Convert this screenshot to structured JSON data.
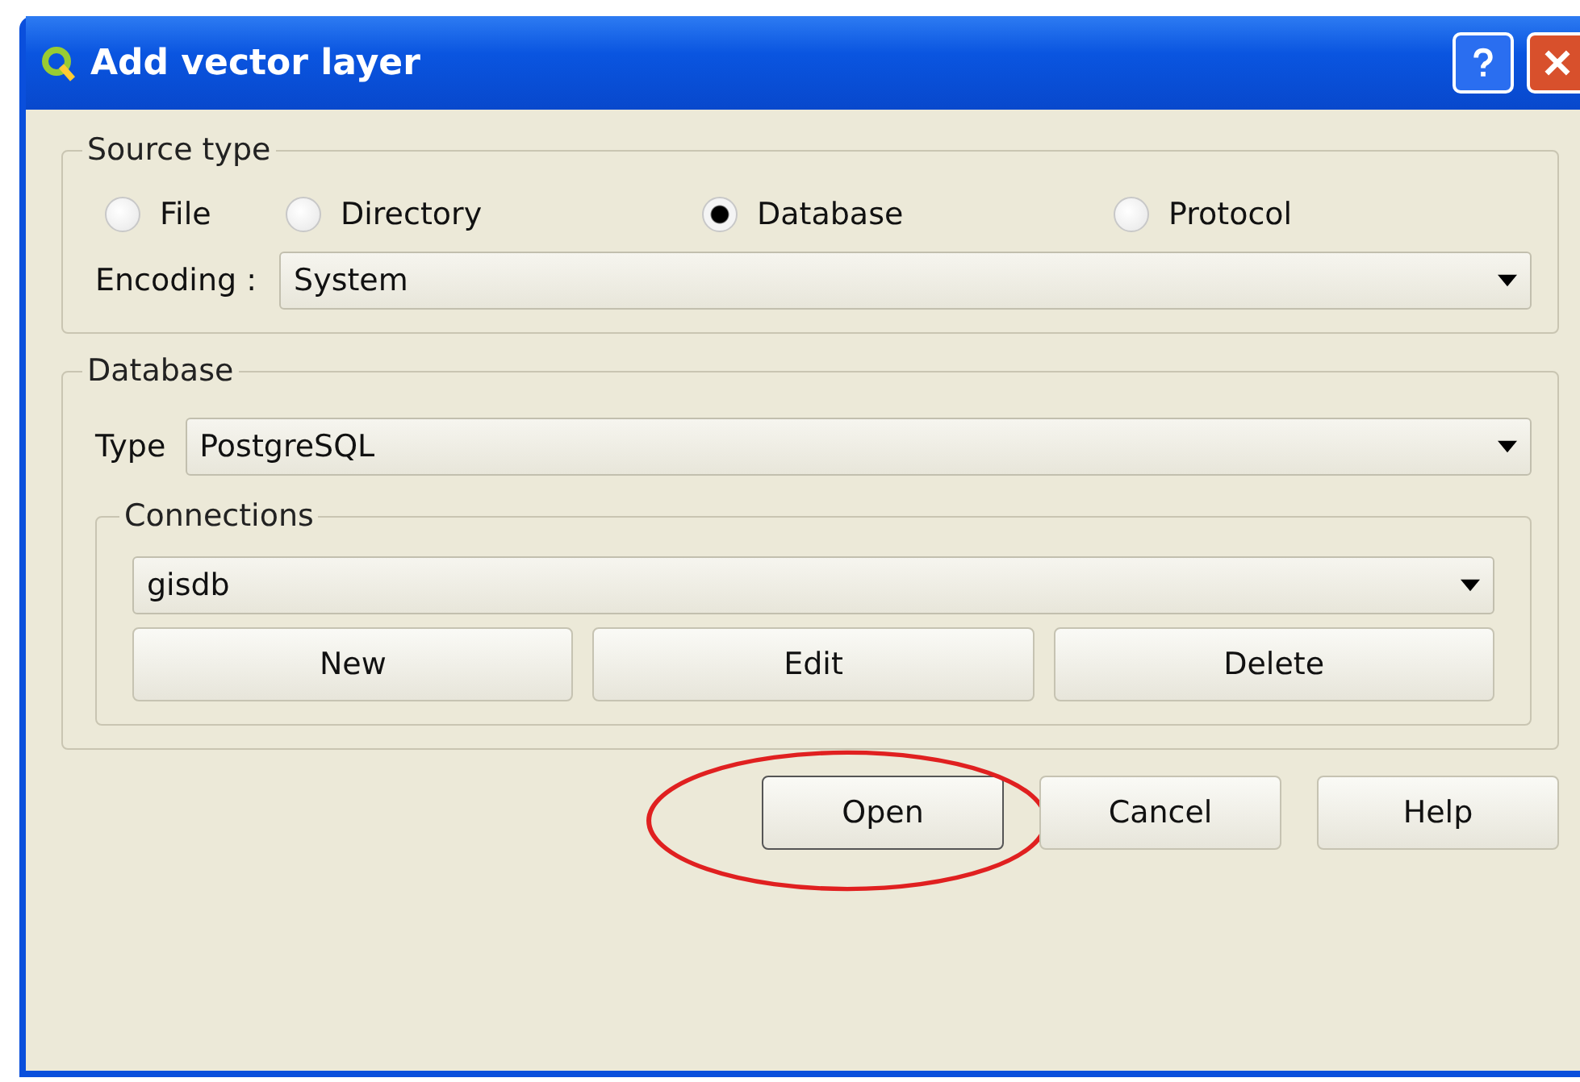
{
  "window": {
    "title": "Add vector layer"
  },
  "source_type": {
    "legend": "Source type",
    "options": [
      {
        "label": "File",
        "selected": false
      },
      {
        "label": "Directory",
        "selected": false
      },
      {
        "label": "Database",
        "selected": true
      },
      {
        "label": "Protocol",
        "selected": false
      }
    ],
    "encoding": {
      "label": "Encoding :",
      "value": "System"
    }
  },
  "database": {
    "legend": "Database",
    "type": {
      "label": "Type",
      "value": "PostgreSQL"
    },
    "connections": {
      "legend": "Connections",
      "value": "gisdb",
      "buttons": [
        "New",
        "Edit",
        "Delete"
      ]
    }
  },
  "buttons": [
    {
      "label": "Open",
      "highlighted": true
    },
    {
      "label": "Cancel",
      "highlighted": false
    },
    {
      "label": "Help",
      "highlighted": false
    }
  ]
}
